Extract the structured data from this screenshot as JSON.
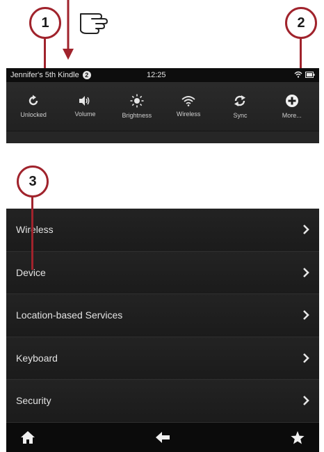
{
  "callouts": [
    "1",
    "2",
    "3"
  ],
  "status_bar": {
    "owner": "Jennifer's 5th Kindle",
    "notification_count": "2",
    "time": "12:25"
  },
  "quick_settings": [
    {
      "label": "Unlocked",
      "icon": "rotation-unlocked-icon"
    },
    {
      "label": "Volume",
      "icon": "volume-icon"
    },
    {
      "label": "Brightness",
      "icon": "brightness-icon"
    },
    {
      "label": "Wireless",
      "icon": "wifi-icon"
    },
    {
      "label": "Sync",
      "icon": "sync-icon"
    },
    {
      "label": "More...",
      "icon": "plus-circle-icon"
    }
  ],
  "settings_list": [
    {
      "label": "Wireless"
    },
    {
      "label": "Device"
    },
    {
      "label": "Location-based Services"
    },
    {
      "label": "Keyboard"
    },
    {
      "label": "Security"
    }
  ],
  "nav_bar": [
    "home-icon",
    "back-arrow-icon",
    "star-icon"
  ],
  "colors": {
    "callout_accent": "#a0232c",
    "panel_bg": "#1e1e1e",
    "status_bg": "#0d0d0d",
    "text": "#e3e3e3"
  }
}
